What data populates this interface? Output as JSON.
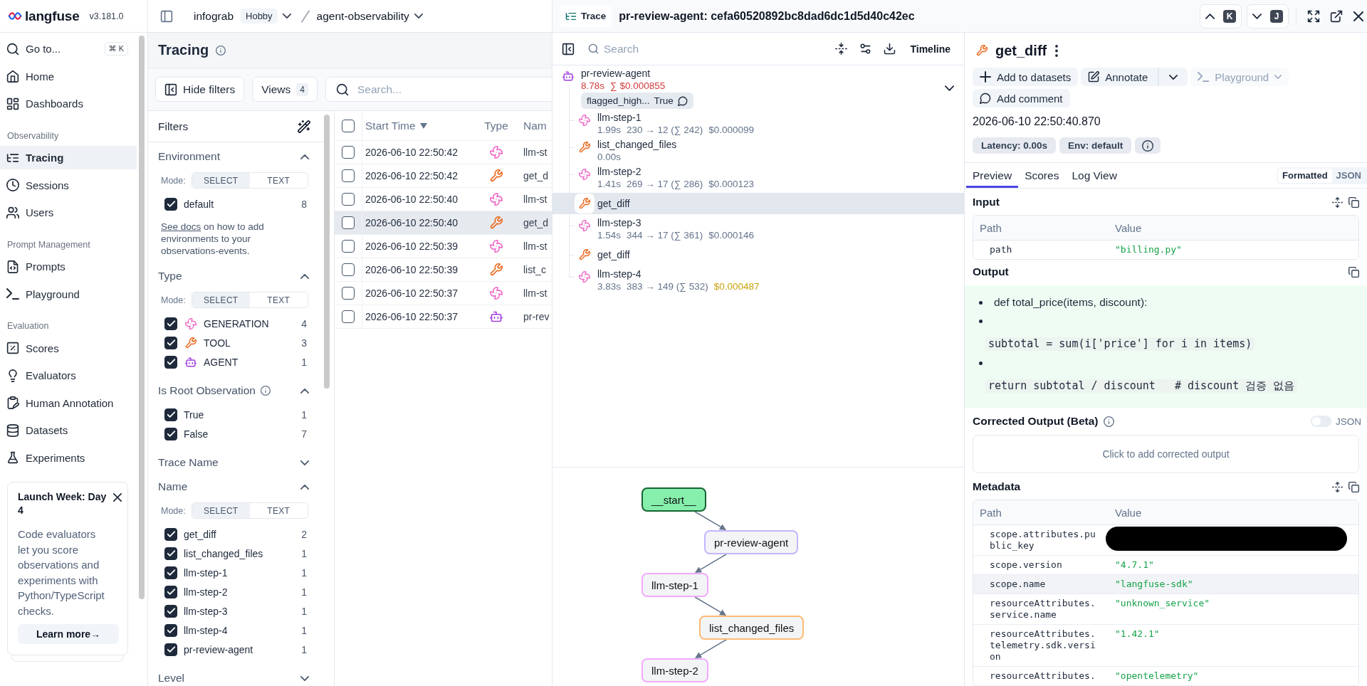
{
  "sidebar": {
    "brand": "langfuse",
    "version": "v3.181.0",
    "goto": {
      "label": "Go to...",
      "shortcut": "⌘ K"
    },
    "sections": [
      {
        "items": [
          {
            "label": "Home",
            "kind": "home",
            "selected": false
          },
          {
            "label": "Dashboards",
            "kind": "dashboards",
            "selected": false
          }
        ]
      },
      {
        "title": "Observability",
        "items": [
          {
            "label": "Tracing",
            "kind": "tracing",
            "selected": true
          },
          {
            "label": "Sessions",
            "kind": "sessions",
            "selected": false
          },
          {
            "label": "Users",
            "kind": "users",
            "selected": false
          }
        ]
      },
      {
        "title": "Prompt Management",
        "items": [
          {
            "label": "Prompts",
            "kind": "prompts",
            "selected": false
          },
          {
            "label": "Playground",
            "kind": "playground",
            "selected": false
          }
        ]
      },
      {
        "title": "Evaluation",
        "items": [
          {
            "label": "Scores",
            "kind": "scores",
            "selected": false
          },
          {
            "label": "Evaluators",
            "kind": "evaluators",
            "selected": false
          },
          {
            "label": "Human Annotation",
            "kind": "annotation",
            "selected": false
          },
          {
            "label": "Datasets",
            "kind": "datasets",
            "selected": false
          },
          {
            "label": "Experiments",
            "kind": "experiments",
            "selected": false
          }
        ]
      }
    ],
    "promo": {
      "title": "Launch Week: Day 4",
      "body": "Code evaluators let you score observations and experiments with Python/TypeScript checks.",
      "button": "Learn more→"
    }
  },
  "topbar": {
    "org": "infograb",
    "plan": "Hobby",
    "project": "agent-observability"
  },
  "page": {
    "title": "Tracing",
    "hide_filters": "Hide filters",
    "views": {
      "label": "Views",
      "count": "4"
    },
    "search": {
      "placeholder": "Search..."
    }
  },
  "filters": {
    "title": "Filters",
    "groups": [
      {
        "title": "Environment",
        "info": false,
        "expanded": true,
        "mode": {
          "label": "Mode:",
          "options": [
            {
              "label": "SELECT",
              "selected": true
            },
            {
              "label": "TEXT",
              "selected": false
            }
          ]
        },
        "options": [
          {
            "label": "default",
            "count": "8",
            "checked": true
          }
        ],
        "note": {
          "link": "See docs",
          "text": " on how to add environments to your observations-events."
        }
      },
      {
        "title": "Type",
        "info": false,
        "expanded": true,
        "mode": {
          "label": "Mode:",
          "options": [
            {
              "label": "SELECT",
              "selected": true
            },
            {
              "label": "TEXT",
              "selected": false
            }
          ]
        },
        "options": [
          {
            "label": "GENERATION",
            "kind": "generation",
            "count": "4",
            "checked": true
          },
          {
            "label": "TOOL",
            "kind": "tool",
            "count": "3",
            "checked": true
          },
          {
            "label": "AGENT",
            "kind": "agent",
            "count": "1",
            "checked": true
          }
        ]
      },
      {
        "title": "Is Root Observation",
        "info": true,
        "expanded": true,
        "options": [
          {
            "label": "True",
            "count": "1",
            "checked": true
          },
          {
            "label": "False",
            "count": "7",
            "checked": true
          }
        ]
      },
      {
        "title": "Trace Name",
        "info": false,
        "expanded": false
      },
      {
        "title": "Name",
        "info": false,
        "expanded": true,
        "mode": {
          "label": "Mode:",
          "options": [
            {
              "label": "SELECT",
              "selected": true
            },
            {
              "label": "TEXT",
              "selected": false
            }
          ]
        },
        "options": [
          {
            "label": "get_diff",
            "count": "2",
            "checked": true
          },
          {
            "label": "list_changed_files",
            "count": "1",
            "checked": true
          },
          {
            "label": "llm-step-1",
            "count": "1",
            "checked": true
          },
          {
            "label": "llm-step-2",
            "count": "1",
            "checked": true
          },
          {
            "label": "llm-step-3",
            "count": "1",
            "checked": true
          },
          {
            "label": "llm-step-4",
            "count": "1",
            "checked": true
          },
          {
            "label": "pr-review-agent",
            "count": "1",
            "checked": true
          }
        ]
      },
      {
        "title": "Level",
        "info": false,
        "expanded": false
      }
    ]
  },
  "table": {
    "all_checked": false,
    "columns": [
      {
        "label": "Start Time",
        "sorted_desc": true
      },
      {
        "label": "Type",
        "sorted_desc": false
      },
      {
        "label": "Nam",
        "sorted_desc": false
      }
    ],
    "rows": [
      {
        "checked": false,
        "selected": false,
        "start_time": "2026-06-10 22:50:42",
        "kind": "generation",
        "name": "llm-st"
      },
      {
        "checked": false,
        "selected": false,
        "start_time": "2026-06-10 22:50:42",
        "kind": "tool",
        "name": "get_d"
      },
      {
        "checked": false,
        "selected": false,
        "start_time": "2026-06-10 22:50:40",
        "kind": "generation",
        "name": "llm-st"
      },
      {
        "checked": false,
        "selected": true,
        "start_time": "2026-06-10 22:50:40",
        "kind": "tool",
        "name": "get_d"
      },
      {
        "checked": false,
        "selected": false,
        "start_time": "2026-06-10 22:50:39",
        "kind": "generation",
        "name": "llm-st"
      },
      {
        "checked": false,
        "selected": false,
        "start_time": "2026-06-10 22:50:39",
        "kind": "tool",
        "name": "list_c"
      },
      {
        "checked": false,
        "selected": false,
        "start_time": "2026-06-10 22:50:37",
        "kind": "generation",
        "name": "llm-st"
      },
      {
        "checked": false,
        "selected": false,
        "start_time": "2026-06-10 22:50:37",
        "kind": "agent",
        "name": "pr-rev"
      }
    ]
  },
  "trace_sheet": {
    "badge": "Trace",
    "title": "pr-review-agent: cefa60520892bc8dad6dc1d5d40c42ec",
    "nav": [
      {
        "kind": "up",
        "shortcut": "K"
      },
      {
        "kind": "down",
        "shortcut": "J"
      }
    ]
  },
  "trace": {
    "search": {
      "placeholder": "Search"
    },
    "timeline": "Timeline",
    "tree": [
      {
        "name": "pr-review-agent",
        "kind": "agent",
        "selected": false,
        "expanded": true,
        "metrics": [
          {
            "text": "8.78s",
            "color": "#d03b3b"
          },
          {
            "text": "∑ $0.000855",
            "color": "#d03b3b"
          }
        ],
        "scores": [
          {
            "name": "flagged_high...",
            "value": "True",
            "comment": true
          }
        ],
        "children": [
          {
            "name": "llm-step-1",
            "kind": "generation",
            "selected": false,
            "metrics": [
              {
                "text": "1.99s",
                "color": "#64748b"
              },
              {
                "text": "230 → 12 (∑ 242)",
                "color": "#64748b"
              },
              {
                "text": "$0.000099",
                "color": "#64748b"
              }
            ]
          },
          {
            "name": "list_changed_files",
            "kind": "tool",
            "selected": false,
            "metrics": [
              {
                "text": "0.00s",
                "color": "#64748b"
              }
            ]
          },
          {
            "name": "llm-step-2",
            "kind": "generation",
            "selected": false,
            "metrics": [
              {
                "text": "1.41s",
                "color": "#64748b"
              },
              {
                "text": "269 → 17 (∑ 286)",
                "color": "#64748b"
              },
              {
                "text": "$0.000123",
                "color": "#64748b"
              }
            ]
          },
          {
            "name": "get_diff",
            "kind": "tool",
            "selected": true
          },
          {
            "name": "llm-step-3",
            "kind": "generation",
            "selected": false,
            "metrics": [
              {
                "text": "1.54s",
                "color": "#64748b"
              },
              {
                "text": "344 → 17 (∑ 361)",
                "color": "#64748b"
              },
              {
                "text": "$0.000146",
                "color": "#64748b"
              }
            ]
          },
          {
            "name": "get_diff",
            "kind": "tool",
            "selected": false
          },
          {
            "name": "llm-step-4",
            "kind": "generation",
            "selected": false,
            "metrics": [
              {
                "text": "3.83s",
                "color": "#64748b"
              },
              {
                "text": "383 → 149 (∑ 532)",
                "color": "#64748b"
              },
              {
                "text": "$0.000487",
                "color": "#c9a10a"
              }
            ]
          }
        ]
      }
    ],
    "graph": {
      "nodes": [
        {
          "label": "__start__",
          "kind": "start"
        },
        {
          "label": "pr-review-agent",
          "kind": "agent"
        },
        {
          "label": "llm-step-1",
          "kind": "generation"
        },
        {
          "label": "list_changed_files",
          "kind": "tool"
        },
        {
          "label": "llm-step-2",
          "kind": "generation"
        }
      ]
    }
  },
  "detail": {
    "kind": "tool",
    "title": "get_diff",
    "actions": [
      {
        "kind": "add",
        "label": "Add to datasets",
        "disabled": false
      },
      {
        "kind": "annotate",
        "label": "Annotate",
        "disabled": false
      },
      {
        "kind": "playground",
        "label": "Playground",
        "disabled": true
      },
      {
        "kind": "comment",
        "label": "Add comment",
        "disabled": false
      }
    ],
    "timestamp": "2026-06-10 22:50:40.870",
    "badges": [
      {
        "label": "Latency: 0.00s"
      },
      {
        "label": "Env: default"
      }
    ],
    "tabs": [
      {
        "label": "Preview",
        "selected": true
      },
      {
        "label": "Scores",
        "selected": false
      },
      {
        "label": "Log View",
        "selected": false
      }
    ],
    "view_modes": [
      {
        "label": "Formatted",
        "selected": true
      },
      {
        "label": "JSON",
        "selected": false
      }
    ],
    "input": {
      "title": "Input",
      "columns": [
        "Path",
        "Value"
      ],
      "rows": [
        {
          "path": "path",
          "value": "\"billing.py\""
        }
      ]
    },
    "output": {
      "title": "Output",
      "items": [
        {
          "kind": "text",
          "text": "def total_price(items, discount):"
        },
        {
          "kind": "code",
          "text": "subtotal = sum(i['price'] for i in items)"
        },
        {
          "kind": "code",
          "text": "return subtotal / discount   # discount 검증 없음"
        }
      ]
    },
    "corrected": {
      "title": "Corrected Output (Beta)",
      "json_toggle": {
        "label": "JSON",
        "on": false
      },
      "prompt": "Click to add corrected output"
    },
    "metadata": {
      "title": "Metadata",
      "columns": [
        "Path",
        "Value"
      ],
      "rows": [
        {
          "path": "scope.attributes.public_key",
          "redacted": true,
          "hovered": false
        },
        {
          "path": "scope.version",
          "value": "\"4.7.1\"",
          "redacted": false,
          "hovered": false
        },
        {
          "path": "scope.name",
          "value": "\"langfuse-sdk\"",
          "redacted": false,
          "hovered": true
        },
        {
          "path": "resourceAttributes.service.name",
          "value": "\"unknown_service\"",
          "redacted": false,
          "hovered": false
        },
        {
          "path": "resourceAttributes.telemetry.sdk.version",
          "value": "\"1.42.1\"",
          "redacted": false,
          "hovered": false
        },
        {
          "path": "resourceAttributes.",
          "value": "\"opentelemetry\"",
          "redacted": false,
          "hovered": false
        }
      ]
    }
  }
}
